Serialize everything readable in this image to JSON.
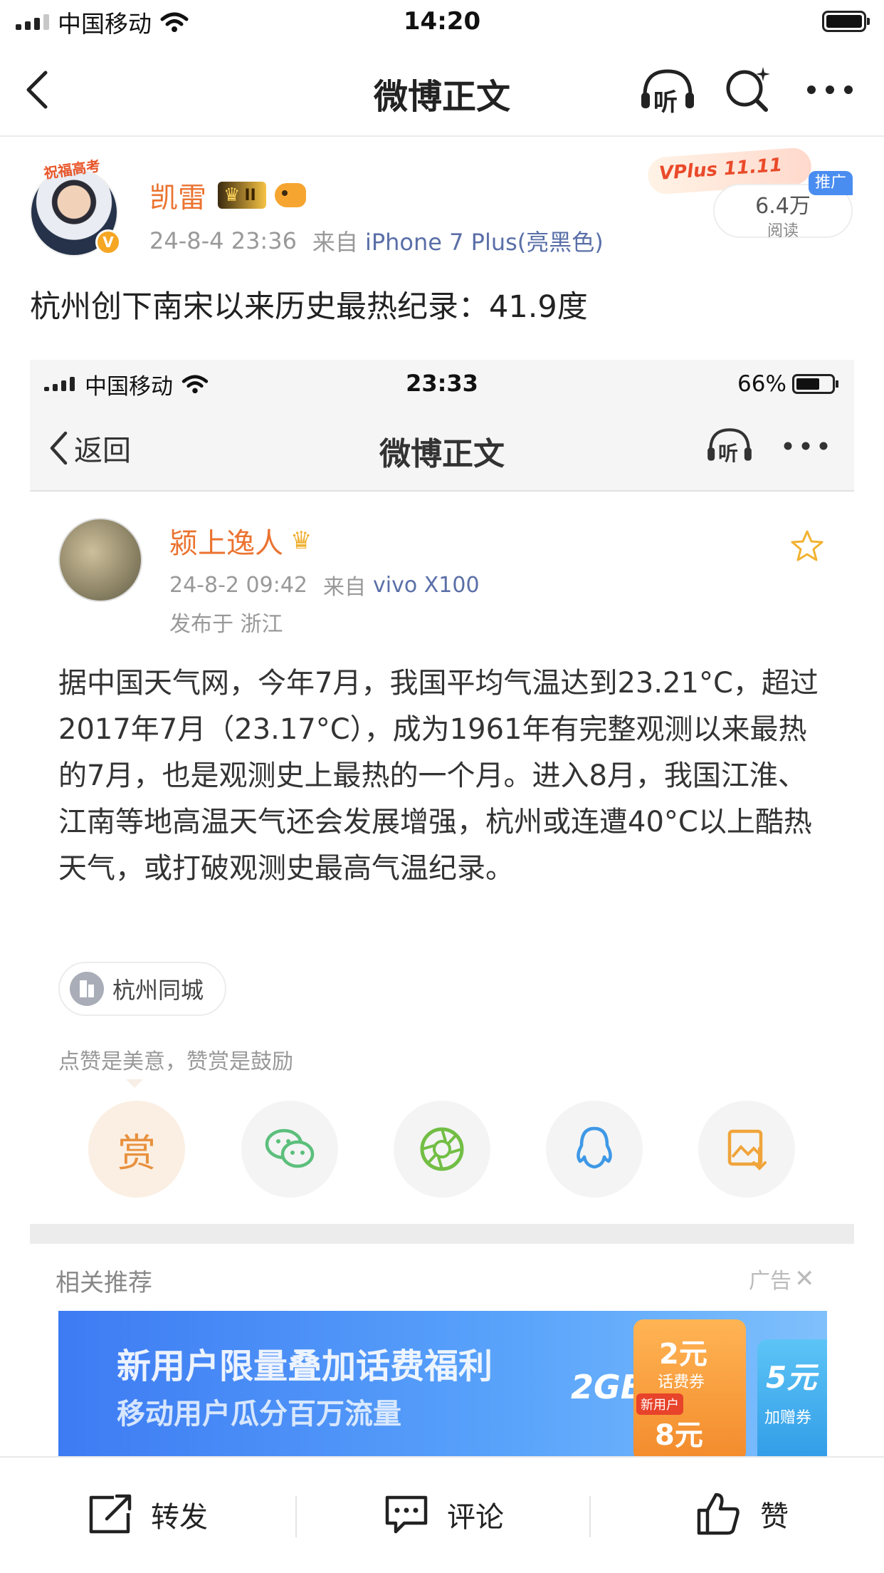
{
  "status_bar": {
    "carrier": "中国移动",
    "time": "14:20"
  },
  "nav": {
    "title": "微博正文",
    "back_icon": "chevron-left-icon",
    "listen_icon": "headphones-listen-icon",
    "listen_label": "听",
    "search_icon": "search-sparkle-icon",
    "more_icon": "more-dots-icon"
  },
  "post": {
    "avatar_badge": "祝福高考",
    "username": "凯雷",
    "level_badge": "II",
    "time": "24-8-4 23:36",
    "source_prefix": "来自",
    "source_device": "iPhone 7 Plus(亮黑色)",
    "vplus_badge": "VPlus 11.11",
    "reads_count": "6.4万",
    "reads_label": "阅读",
    "promo_tag": "推广",
    "text": "杭州创下南宋以来历史最热纪录：41.9度"
  },
  "screenshot": {
    "status": {
      "carrier": "中国移动",
      "time": "23:33",
      "battery": "66%"
    },
    "nav": {
      "back_label": "返回",
      "title": "微博正文",
      "listen_label": "听"
    },
    "author": {
      "username": "颍上逸人",
      "time": "24-8-2 09:42",
      "source_prefix": "来自",
      "source_device": "vivo X100",
      "location": "发布于 浙江"
    },
    "body": "据中国天气网，今年7月，我国平均气温达到23.21°C，超过2017年7月（23.17°C），成为1961年有完整观测以来最热的7月，也是观测史上最热的一个月。进入8月，我国江淮、江南等地高温天气还会发展增强，杭州或连遭40°C以上酷热天气，或打破观测史最高气温纪录。",
    "topic_tag": "杭州同城",
    "reward_tip": "点赞是美意，赞赏是鼓励",
    "share_buttons": [
      {
        "icon": "reward-icon",
        "label": "赏"
      },
      {
        "icon": "wechat-icon"
      },
      {
        "icon": "moments-icon"
      },
      {
        "icon": "qq-icon"
      },
      {
        "icon": "save-image-icon"
      }
    ],
    "related_title": "相关推荐",
    "ad_label": "广告",
    "banner": {
      "headline": "新用户限量叠加话费福利",
      "subline": "移动用户瓜分百万流量",
      "data_amount": "2GB",
      "coupon_amount_1": "2元",
      "coupon_label_1": "话费券",
      "new_user_tag": "新用户",
      "coupon_amount_2": "8元",
      "coupon_amount_3": "5元",
      "coupon_label_3": "加赠券"
    }
  },
  "bottom_bar": {
    "repost": "转发",
    "comment": "评论",
    "like": "赞"
  },
  "colors": {
    "brand_orange": "#e86b1f",
    "link_blue": "#5a6fa8",
    "username_orange": "#eb7330"
  }
}
